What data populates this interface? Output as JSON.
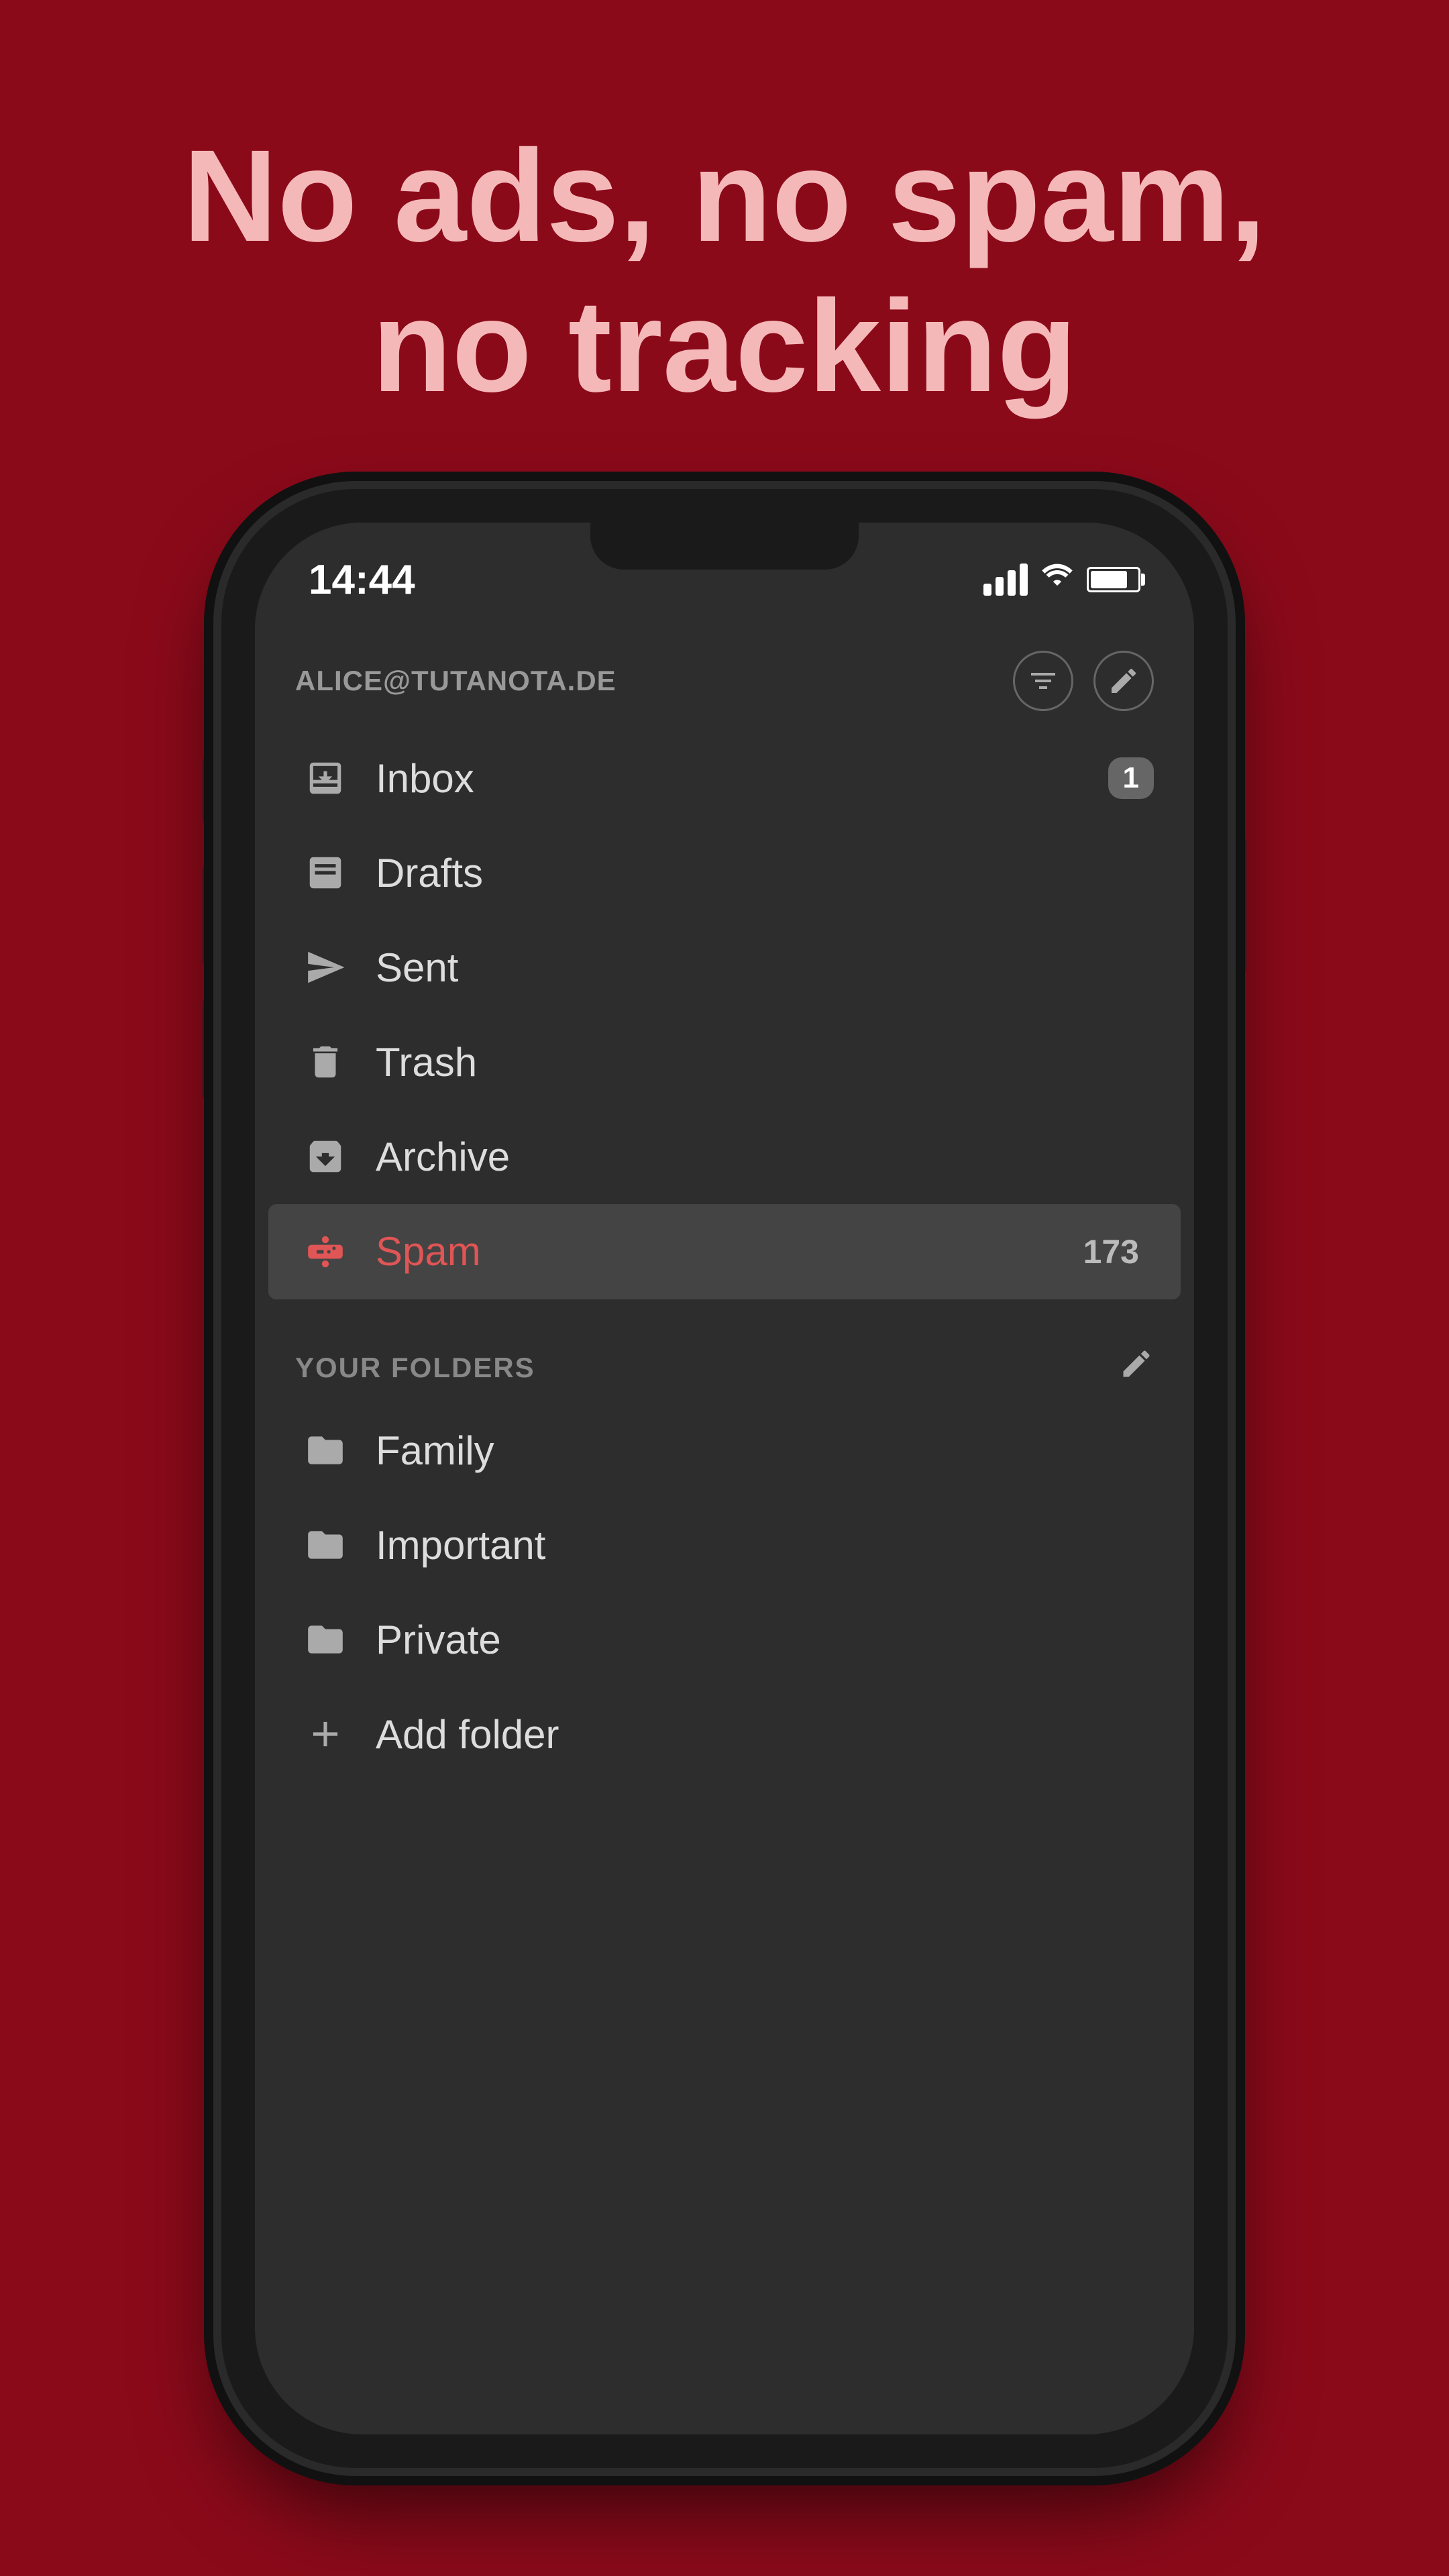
{
  "headline": {
    "line1": "No ads, no spam,",
    "line2": "no tracking"
  },
  "phone": {
    "statusBar": {
      "time": "14:44",
      "signalBars": [
        1,
        2,
        3,
        4
      ],
      "battery": 85
    },
    "account": {
      "email": "ALICE@TUTANOTA.DE"
    },
    "headerIcons": {
      "filter": "☰",
      "compose": "✎"
    },
    "navItems": [
      {
        "id": "inbox",
        "label": "Inbox",
        "badge": "1",
        "active": false
      },
      {
        "id": "drafts",
        "label": "Drafts",
        "badge": "",
        "active": false
      },
      {
        "id": "sent",
        "label": "Sent",
        "badge": "",
        "active": false
      },
      {
        "id": "trash",
        "label": "Trash",
        "badge": "",
        "active": false
      },
      {
        "id": "archive",
        "label": "Archive",
        "badge": "",
        "active": false
      },
      {
        "id": "spam",
        "label": "Spam",
        "badge": "173",
        "active": true
      }
    ],
    "foldersSection": {
      "title": "YOUR FOLDERS",
      "editLabel": "✎",
      "folders": [
        {
          "id": "family",
          "label": "Family"
        },
        {
          "id": "important",
          "label": "Important"
        },
        {
          "id": "private",
          "label": "Private"
        }
      ],
      "addFolder": "Add folder"
    }
  },
  "colors": {
    "background": "#8B0A1A",
    "phoneShell": "#1a1a1a",
    "screenBg": "#2d2d2d",
    "activeItem": "#444444",
    "accentRed": "#e05555",
    "textPrimary": "#dddddd",
    "textSecondary": "#999999",
    "textMuted": "#888888"
  }
}
